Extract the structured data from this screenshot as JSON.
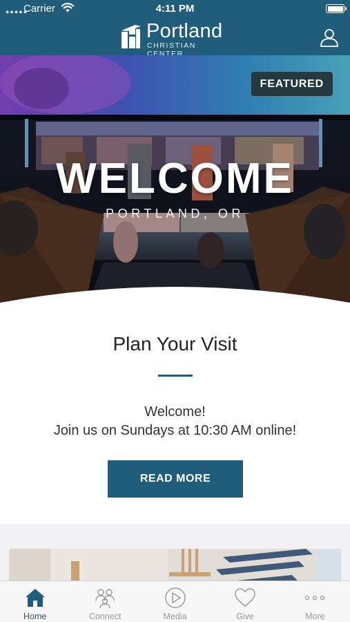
{
  "status_bar": {
    "carrier": "Carrier",
    "time": "4:11 PM"
  },
  "header": {
    "logo_name": "Portland",
    "logo_subtitle": "CHRISTIAN CENTER"
  },
  "hero": {
    "badge": "FEATURED",
    "title": "WELCOME",
    "subtitle": "PORTLAND, OR"
  },
  "card": {
    "title": "Plan Your Visit",
    "line1": "Welcome!",
    "line2": "Join us on Sundays at 10:30 AM online!",
    "button": "READ MORE"
  },
  "tabs": [
    {
      "label": "Home",
      "icon": "home-icon",
      "active": true
    },
    {
      "label": "Connect",
      "icon": "people-icon",
      "active": false
    },
    {
      "label": "Media",
      "icon": "play-icon",
      "active": false
    },
    {
      "label": "Give",
      "icon": "heart-icon",
      "active": false
    },
    {
      "label": "More",
      "icon": "more-icon",
      "active": false
    }
  ],
  "colors": {
    "brand": "#1f5d7b",
    "badge": "#25383f",
    "tab_inactive": "#9a9a9a"
  }
}
